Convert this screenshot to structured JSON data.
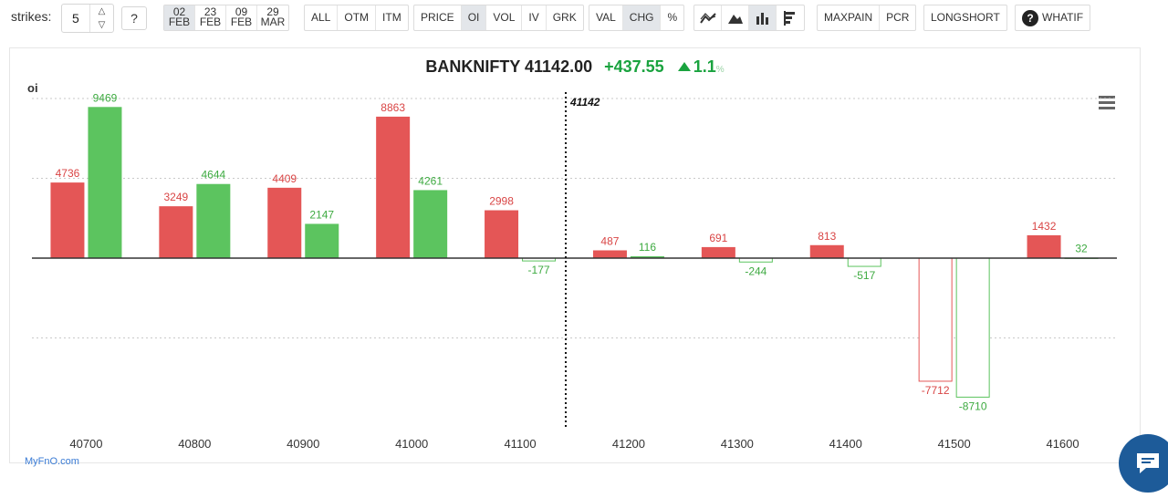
{
  "toolbar": {
    "strikes_label": "strikes:",
    "strikes_value": "5",
    "help_label": "?",
    "expiries": [
      {
        "day": "02",
        "month": "FEB",
        "active": true
      },
      {
        "day": "23",
        "month": "FEB",
        "active": false
      },
      {
        "day": "09",
        "month": "FEB",
        "active": false
      },
      {
        "day": "29",
        "month": "MAR",
        "active": false
      }
    ],
    "filter": [
      "ALL",
      "OTM",
      "ITM"
    ],
    "metric": [
      "PRICE",
      "OI",
      "VOL",
      "IV",
      "GRK"
    ],
    "metric_active": "OI",
    "mode": [
      "VAL",
      "CHG",
      "%"
    ],
    "mode_active": "CHG",
    "chart_types": [
      "line-chart-icon",
      "area-chart-icon",
      "bar-chart-icon",
      "horizontal-bar-chart-icon"
    ],
    "chart_type_active": "bar-chart-icon",
    "analysis": [
      "MAXPAIN",
      "PCR"
    ],
    "longshort_label": "LONGSHORT",
    "whatif_label": "WHATIF"
  },
  "header": {
    "symbol": "BANKNIFTY",
    "price": "41142.00",
    "change": "+437.55",
    "change_pct": "1.1",
    "pct_symbol": "%"
  },
  "brand": "MyFnO.com",
  "colors": {
    "call": "#e45656",
    "put": "#5cc45f",
    "call_label": "#d94545",
    "put_label": "#3daa40",
    "grid": "#c9c9c9",
    "axis": "#333333"
  },
  "chart_data": {
    "type": "bar",
    "ylabel": "oi",
    "categories": [
      "40700",
      "40800",
      "40900",
      "41000",
      "41100",
      "41200",
      "41300",
      "41400",
      "41500",
      "41600"
    ],
    "series": [
      {
        "values": [
          4736,
          3249,
          4409,
          8863,
          2998,
          487,
          691,
          813,
          -7712,
          1432
        ]
      },
      {
        "values": [
          9469,
          4644,
          2147,
          4261,
          -177,
          116,
          -244,
          -517,
          -8710,
          32
        ]
      }
    ],
    "spot_marker": {
      "value": 41142,
      "label": "41142"
    },
    "ylim": [
      -10000,
      10000
    ],
    "grid": true
  }
}
